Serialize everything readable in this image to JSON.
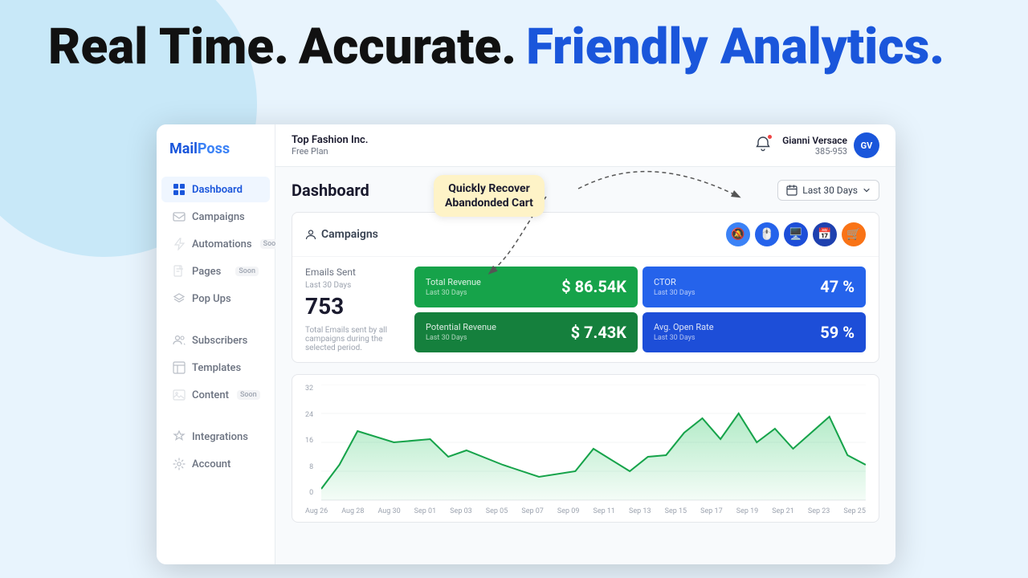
{
  "hero": {
    "part1": "Real Time.",
    "part2": "Accurate.",
    "part3": "Friendly Analytics."
  },
  "app": {
    "logo": {
      "mail": "Mail",
      "poss": "Poss"
    },
    "topbar": {
      "company": "Top Fashion Inc.",
      "plan": "Free Plan",
      "bell_icon": "🔔",
      "user_name": "Gianni Versace",
      "user_id": "385-953",
      "avatar": "GV"
    },
    "sidebar": {
      "items": [
        {
          "id": "dashboard",
          "label": "Dashboard",
          "icon": "grid",
          "active": true,
          "soon": false
        },
        {
          "id": "campaigns",
          "label": "Campaigns",
          "icon": "mail",
          "active": false,
          "soon": false
        },
        {
          "id": "automations",
          "label": "Automations",
          "icon": "zap",
          "active": false,
          "soon": true
        },
        {
          "id": "pages",
          "label": "Pages",
          "icon": "file",
          "active": false,
          "soon": true
        },
        {
          "id": "popups",
          "label": "Pop Ups",
          "icon": "layers",
          "active": false,
          "soon": false
        },
        {
          "id": "subscribers",
          "label": "Subscribers",
          "icon": "users",
          "active": false,
          "soon": false
        },
        {
          "id": "templates",
          "label": "Templates",
          "icon": "layout",
          "active": false,
          "soon": false
        },
        {
          "id": "content",
          "label": "Content",
          "icon": "image",
          "active": false,
          "soon": true
        },
        {
          "id": "integrations",
          "label": "Integrations",
          "icon": "star",
          "active": false,
          "soon": false
        },
        {
          "id": "account",
          "label": "Account",
          "icon": "settings",
          "active": false,
          "soon": false
        }
      ]
    },
    "dashboard": {
      "title": "Dashboard",
      "date_range": "Last 30 Days",
      "campaigns_section": {
        "title": "Campaigns",
        "emails_sent_label": "Emails Sent",
        "emails_sent_sublabel": "Last 30 Days",
        "emails_sent_value": "753",
        "emails_sent_desc": "Total Emails sent by all campaigns during the selected period.",
        "stats": [
          {
            "label": "Total Revenue",
            "sublabel": "Last 30 Days",
            "value": "$ 86.54K",
            "color": "green"
          },
          {
            "label": "CTOR",
            "sublabel": "Last 30 Days",
            "value": "47 %",
            "color": "blue"
          },
          {
            "label": "Potential Revenue",
            "sublabel": "Last 30 Days",
            "value": "$ 7.43K",
            "color": "green2"
          },
          {
            "label": "Avg. Open Rate",
            "sublabel": "Last 30 Days",
            "value": "59 %",
            "color": "blue2"
          }
        ],
        "icon_buttons": [
          "🔕",
          "🖱️",
          "🖥️",
          "📅",
          "🛒"
        ]
      },
      "chart": {
        "y_labels": [
          "32",
          "24",
          "16",
          "8",
          "0"
        ],
        "x_labels": [
          "Aug 26",
          "Aug 28",
          "Aug 30",
          "Sep 01",
          "Sep 03",
          "Sep 05",
          "Sep 07",
          "Sep 09",
          "Sep 11",
          "Sep 13",
          "Sep 15",
          "Sep 17",
          "Sep 19",
          "Sep 21",
          "Sep 23",
          "Sep 25"
        ]
      }
    }
  },
  "tooltip": {
    "line1": "Quickly Recover",
    "line2": "Abandonded Cart"
  }
}
